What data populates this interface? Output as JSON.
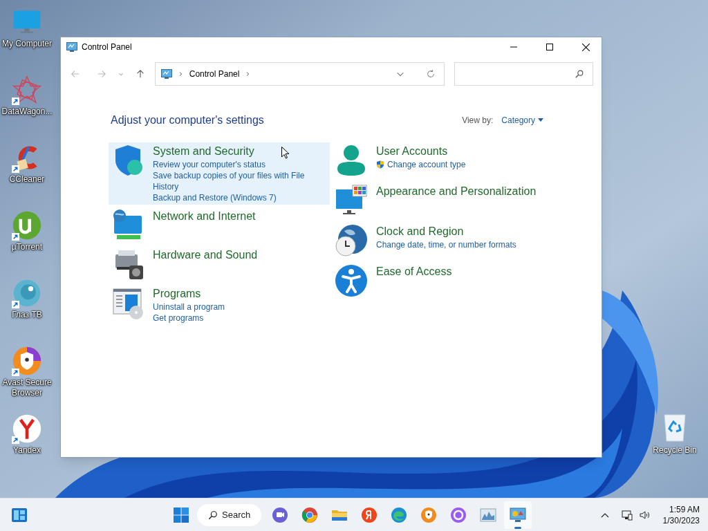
{
  "desktop_icons": [
    {
      "label": "My Computer",
      "shortcut": false
    },
    {
      "label": "DataWagon...",
      "shortcut": true
    },
    {
      "label": "CCleaner",
      "shortcut": true
    },
    {
      "label": "µTorrent",
      "shortcut": true
    },
    {
      "label": "Глаз.ТВ",
      "shortcut": true
    },
    {
      "label": "Avast Secure Browser",
      "shortcut": true
    },
    {
      "label": "Yandex",
      "shortcut": true
    }
  ],
  "recycle_bin": {
    "label": "Recycle Bin"
  },
  "window": {
    "title": "Control Panel",
    "address": {
      "path": "Control Panel"
    },
    "heading": "Adjust your computer's settings",
    "view_by": {
      "label": "View by:",
      "value": "Category"
    },
    "columns": [
      [
        {
          "title": "System and Security",
          "highlighted": true,
          "links": [
            {
              "text": "Review your computer's status",
              "shield": false
            },
            {
              "text": "Save backup copies of your files with File History",
              "shield": false
            },
            {
              "text": "Backup and Restore (Windows 7)",
              "shield": false
            }
          ]
        },
        {
          "title": "Network and Internet",
          "highlighted": false
        },
        {
          "title": "Hardware and Sound",
          "highlighted": false
        },
        {
          "title": "Programs",
          "highlighted": false,
          "links": [
            {
              "text": "Uninstall a program",
              "shield": false
            },
            {
              "text": "Get programs",
              "shield": false
            }
          ]
        }
      ],
      [
        {
          "title": "User Accounts",
          "highlighted": false,
          "links": [
            {
              "text": "Change account type",
              "shield": true
            }
          ]
        },
        {
          "title": "Appearance and Personalization",
          "highlighted": false
        },
        {
          "title": "Clock and Region",
          "highlighted": false,
          "links": [
            {
              "text": "Change date, time, or number formats",
              "shield": false
            }
          ]
        },
        {
          "title": "Ease of Access",
          "highlighted": false
        }
      ]
    ]
  },
  "taskbar": {
    "search": "Search",
    "apps": [
      {
        "running": false
      },
      {
        "running": false
      },
      {
        "running": false
      },
      {
        "running": false
      },
      {
        "running": false
      },
      {
        "running": false
      },
      {
        "running": false
      },
      {
        "running": false
      },
      {
        "running": true
      }
    ],
    "time": "1:59 AM",
    "date": "1/30/2023"
  }
}
